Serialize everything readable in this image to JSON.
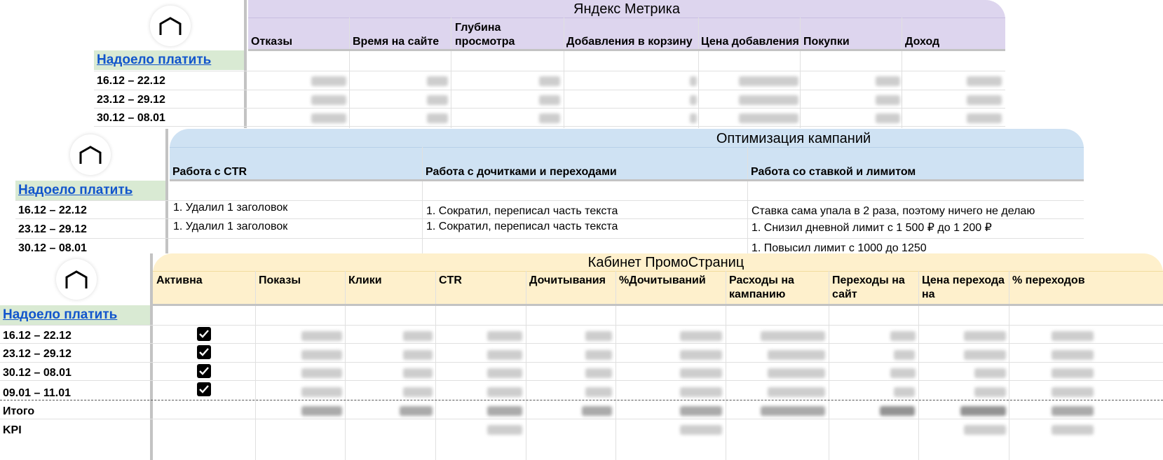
{
  "panels": {
    "metrika": {
      "title": "Яндекс Метрика",
      "link": "Надоело платить",
      "headers": [
        "Отказы",
        "Время на сайте",
        "Глубина просмотра",
        "Добавления в корзину",
        "Цена добавления",
        "Покупки",
        "Доход"
      ],
      "dates": [
        "16.12 – 22.12",
        "23.12 – 29.12",
        "30.12 – 08.01"
      ],
      "header_color": "#ddd5ee"
    },
    "optimization": {
      "title": "Оптимизация кампаний",
      "link": "Надоело платить",
      "headers": [
        "Работа с CTR",
        "Работа с дочитками и переходами",
        "Работа со ставкой и лимитом"
      ],
      "dates": [
        "16.12 – 22.12",
        "23.12 – 29.12",
        "30.12 – 08.01"
      ],
      "rows": [
        [
          "1. Удалил 1 заголовок",
          "1. Сократил, переписал часть текста",
          "Ставка сама упала в 2 раза, поэтому ничего не делаю"
        ],
        [
          "1. Удалил 1 заголовок",
          "1. Сократил, переписал часть текста",
          "1. Снизил дневной лимит с 1 500 ₽ до 1 200 ₽"
        ],
        [
          "",
          "",
          "1. Повысил лимит с 1000 до 1250"
        ]
      ],
      "header_color": "#cfe2f3"
    },
    "promo": {
      "title": "Кабинет ПромоСтраниц",
      "link": "Надоело платить",
      "headers": [
        "Активна",
        "Показы",
        "Клики",
        "CTR",
        "Дочитывания",
        "%Дочитываний",
        "Расходы на кампанию",
        "Переходы на сайт",
        "Цена перехода на",
        "% переходов"
      ],
      "dates": [
        "16.12 – 22.12",
        "23.12 – 29.12",
        "30.12 – 08.01",
        "09.01 – 11.01"
      ],
      "summary_rows": [
        "Итого",
        "KPI"
      ],
      "header_color": "#fef0cc"
    }
  }
}
